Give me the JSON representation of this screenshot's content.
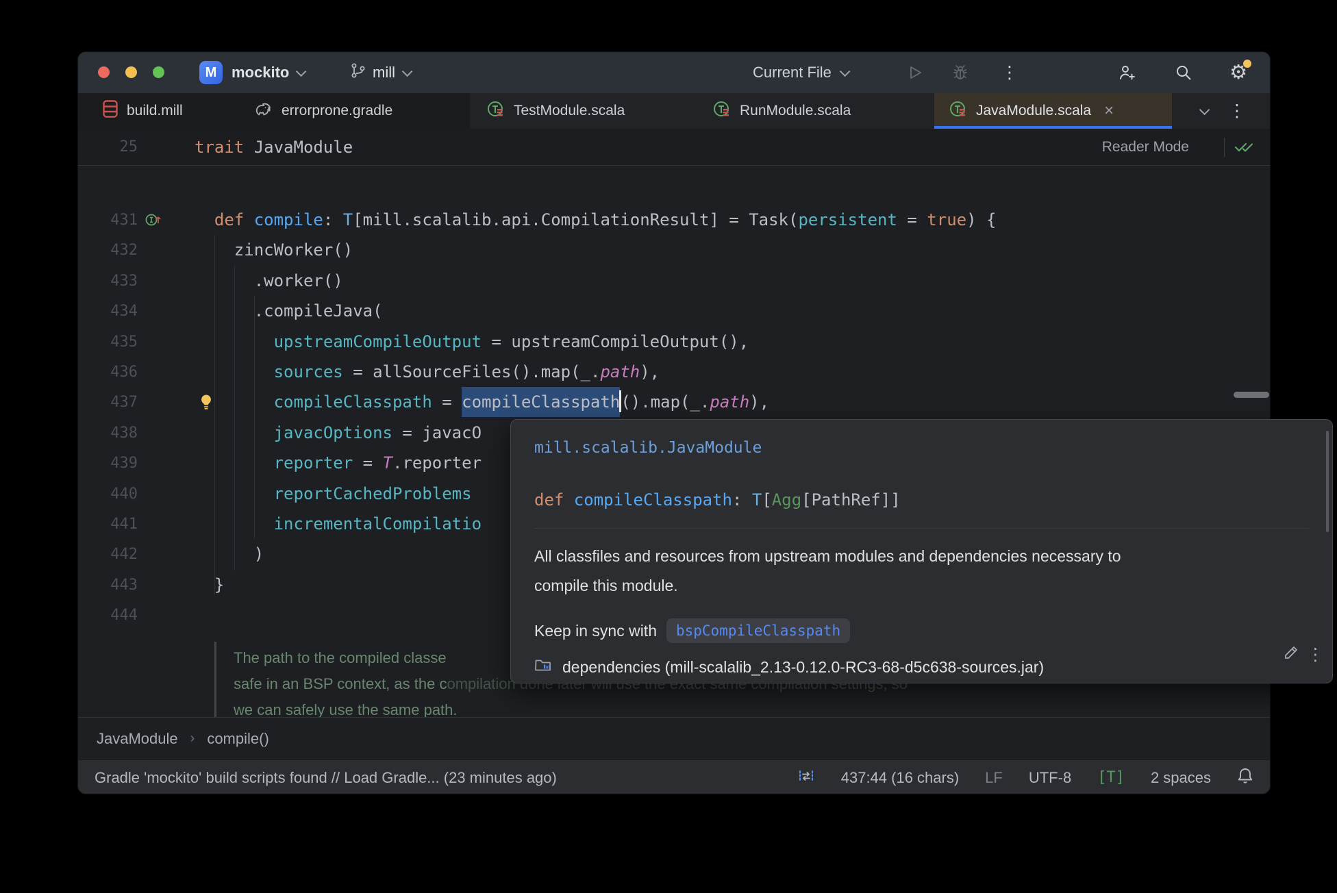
{
  "titlebar": {
    "project_name": "mockito",
    "project_badge": "M",
    "branch_name": "mill",
    "run_config": "Current File"
  },
  "tabs": [
    {
      "label": "build.mill",
      "icon": "mill-file-icon"
    },
    {
      "label": "errorprone.gradle",
      "icon": "gradle-file-icon"
    },
    {
      "label": "TestModule.scala",
      "icon": "scala-file-icon"
    },
    {
      "label": "RunModule.scala",
      "icon": "scala-file-icon"
    },
    {
      "label": "JavaModule.scala",
      "icon": "scala-file-icon",
      "active": true
    }
  ],
  "sticky": {
    "line_number": "25",
    "kw": "trait ",
    "name": "JavaModule",
    "reader_mode_label": "Reader Mode"
  },
  "editor": {
    "lines": [
      {
        "num": "431",
        "gutter": "override",
        "segments": [
          {
            "t": "  "
          },
          {
            "t": "def ",
            "s": "kw"
          },
          {
            "t": "compile",
            "s": "fn"
          },
          {
            "t": ": "
          },
          {
            "t": "T",
            "s": "type"
          },
          {
            "t": "[mill.scalalib.api.CompilationResult] = Task("
          },
          {
            "t": "persistent",
            "s": "named"
          },
          {
            "t": " = "
          },
          {
            "t": "true",
            "s": "kw"
          },
          {
            "t": ") {"
          }
        ]
      },
      {
        "num": "432",
        "segments": [
          {
            "t": "    zincWorker()"
          }
        ]
      },
      {
        "num": "433",
        "segments": [
          {
            "t": "      .worker()"
          }
        ]
      },
      {
        "num": "434",
        "segments": [
          {
            "t": "      .compileJava("
          }
        ]
      },
      {
        "num": "435",
        "segments": [
          {
            "t": "        "
          },
          {
            "t": "upstreamCompileOutput",
            "s": "named"
          },
          {
            "t": " = upstreamCompileOutput(),"
          }
        ]
      },
      {
        "num": "436",
        "segments": [
          {
            "t": "        "
          },
          {
            "t": "sources",
            "s": "named"
          },
          {
            "t": " = allSourceFiles().map(_."
          },
          {
            "t": "path",
            "s": "field"
          },
          {
            "t": "),"
          }
        ]
      },
      {
        "num": "437",
        "gutter": "bulb",
        "segments": [
          {
            "t": "        "
          },
          {
            "t": "compileClasspath",
            "s": "named"
          },
          {
            "t": " = "
          },
          {
            "t": "compileClasspath",
            "s": "sel"
          },
          {
            "s": "caret"
          },
          {
            "t": "().map(_."
          },
          {
            "t": "path",
            "s": "field"
          },
          {
            "t": "),"
          }
        ]
      },
      {
        "num": "438",
        "segments": [
          {
            "t": "        "
          },
          {
            "t": "javacOptions",
            "s": "named"
          },
          {
            "t": " = javacO"
          }
        ]
      },
      {
        "num": "439",
        "segments": [
          {
            "t": "        "
          },
          {
            "t": "reporter",
            "s": "named"
          },
          {
            "t": " = "
          },
          {
            "t": "T",
            "s": "field"
          },
          {
            "t": ".reporter"
          }
        ]
      },
      {
        "num": "440",
        "segments": [
          {
            "t": "        "
          },
          {
            "t": "reportCachedProblems",
            "s": "named"
          }
        ]
      },
      {
        "num": "441",
        "segments": [
          {
            "t": "        "
          },
          {
            "t": "incrementalCompilatio",
            "s": "named"
          }
        ]
      },
      {
        "num": "442",
        "segments": [
          {
            "t": "      )"
          }
        ]
      },
      {
        "num": "443",
        "segments": [
          {
            "t": "  }"
          }
        ]
      },
      {
        "num": "444",
        "segments": []
      }
    ],
    "doc_comment": [
      {
        "parts": [
          {
            "t": "The path to the compiled classe"
          }
        ]
      },
      {
        "parts": [
          {
            "t": "safe in an BSP context, as the c"
          },
          {
            "t": "ompilation done later will use the exact same compilation settings, so",
            "dim": true
          }
        ]
      },
      {
        "parts": [
          {
            "t": "we can safely use the same path."
          }
        ]
      }
    ]
  },
  "popup": {
    "qualifier": "mill.scalalib.JavaModule",
    "signature": [
      {
        "t": "def ",
        "s": "kw"
      },
      {
        "t": "compileClasspath",
        "s": "fn"
      },
      {
        "t": ": "
      },
      {
        "t": "T",
        "s": "type"
      },
      {
        "t": "["
      },
      {
        "t": "Agg",
        "s": "green"
      },
      {
        "t": "[PathRef]]"
      }
    ],
    "description_line1": "All classfiles and resources from upstream modules and dependencies necessary to",
    "description_line2": "compile this module.",
    "keep_in_sync_label": "Keep in sync with",
    "keep_in_sync_code": "bspCompileClasspath",
    "source": "dependencies (mill-scalalib_2.13-0.12.0-RC3-68-d5c638-sources.jar)"
  },
  "breadcrumbs": {
    "item1": "JavaModule",
    "separator": "›",
    "item2": "compile()"
  },
  "statusbar": {
    "message": "Gradle 'mockito' build scripts found // Load Gradle... (23 minutes ago)",
    "caret_position": "437:44 (16 chars)",
    "line_ending": "LF",
    "encoding": "UTF-8",
    "file_type_badge": "[T]",
    "indent": "2 spaces"
  },
  "icons": [
    "traffic-lights",
    "project-badge",
    "chevron-down-icon",
    "git-branch-icon",
    "run-icon",
    "debug-icon",
    "kebab-menu-icon",
    "add-user-icon",
    "search-icon",
    "gear-icon",
    "mill-file-icon",
    "gradle-file-icon",
    "scala-file-icon",
    "close-icon",
    "checks-icon",
    "override-gutter-icon",
    "lightbulb-icon",
    "library-folder-icon",
    "edit-pencil-icon",
    "sync-icon",
    "bell-icon"
  ],
  "colors": {
    "accent": "#3574F0",
    "selection": "#2B4C78",
    "keyword": "#CF8E6D",
    "function": "#56A8F5",
    "named_argument": "#56B6C2",
    "field_italic": "#C77DBB",
    "type_green": "#57965C",
    "doc_comment": "#68876F",
    "notification_dot": "#F2C55C"
  }
}
